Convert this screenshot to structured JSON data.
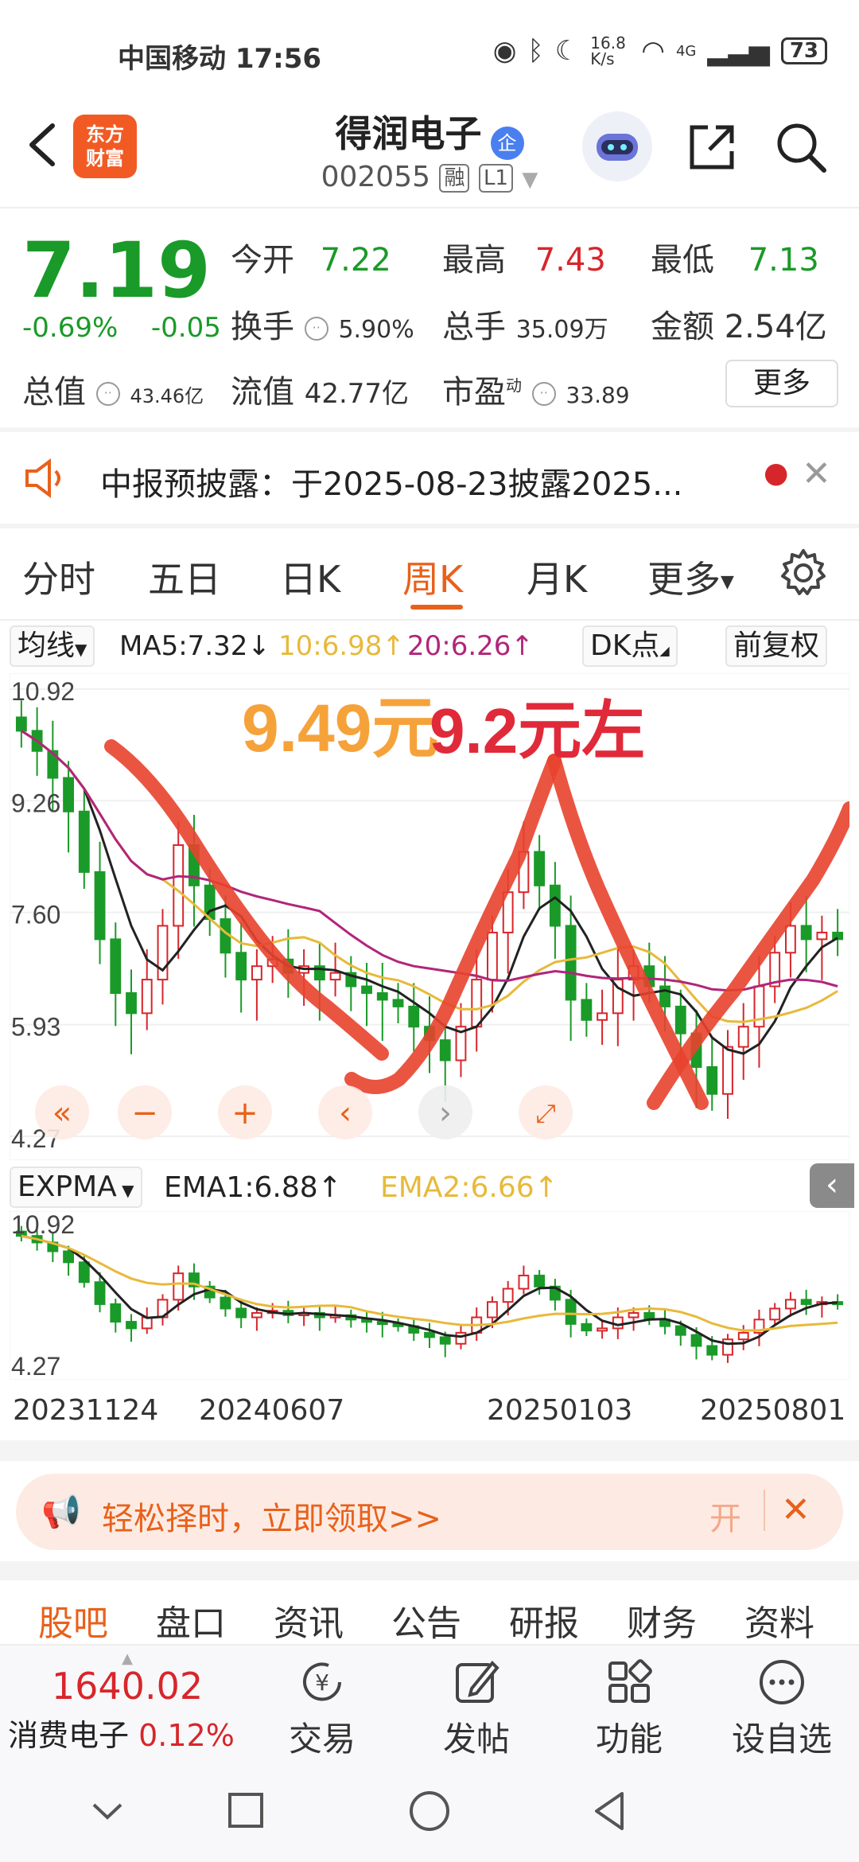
{
  "status_bar": {
    "carrier_time": "中国移动 17:56",
    "net_speed": "16.8 K/s",
    "signal_label": "4G",
    "battery": "73"
  },
  "header": {
    "logo_text_1": "东方",
    "logo_text_2": "财富",
    "stock_name": "得润电子",
    "badge": "企",
    "stock_code": "002055",
    "tag_margin": "融",
    "tag_level": "L1"
  },
  "quote": {
    "price": "7.19",
    "change_pct": "-0.69%",
    "change_abs": "-0.05",
    "open_label": "今开",
    "open": "7.22",
    "high_label": "最高",
    "high": "7.43",
    "low_label": "最低",
    "low": "7.13",
    "turnover_label": "换手",
    "turnover": "5.90%",
    "volume_label": "总手",
    "volume": "35.09万",
    "amount_label": "金额",
    "amount": "2.54亿",
    "mktcap_label": "总值",
    "mktcap": "43.46亿",
    "float_label": "流值",
    "float": "42.77亿",
    "pe_label": "市盈",
    "pe_sup": "动",
    "pe": "33.89",
    "more": "更多"
  },
  "notice": {
    "text": "中报预披露：于2025-08-23披露2025..."
  },
  "chart_tabs": [
    "分时",
    "五日",
    "日K",
    "周K",
    "月K",
    "更多"
  ],
  "active_tab": "周K",
  "ma_row": {
    "selector": "均线",
    "ma5": "MA5:7.32↓",
    "ma10": "10:6.98↑",
    "ma20": "20:6.26↑",
    "dk": "DK点",
    "adjust": "前复权"
  },
  "main_chart": {
    "y_labels": [
      "10.92",
      "9.26",
      "7.60",
      "5.93",
      "4.27"
    ],
    "annotation_1": "9.49元",
    "annotation_2": "9.2元左"
  },
  "sub_row": {
    "indicator": "EXPMA",
    "ema1": "EMA1:6.88↑",
    "ema2": "EMA2:6.66↑"
  },
  "sub_chart": {
    "y_labels": [
      "10.92",
      "4.27"
    ]
  },
  "dates": [
    "20231124",
    "20240607",
    "20250103",
    "20250801"
  ],
  "banner": {
    "text": "轻松择时，立即领取>>",
    "open": "开"
  },
  "bottom_tabs": [
    "股吧",
    "盘口",
    "资讯",
    "公告",
    "研报",
    "财务",
    "资料"
  ],
  "active_bottom_tab": "股吧",
  "bottom_bar": {
    "index_value": "1640.02",
    "index_name": "消费电子",
    "index_change": "0.12%",
    "trade": "交易",
    "post": "发帖",
    "func": "功能",
    "watch": "设自选"
  },
  "colors": {
    "accent": "#e8611b",
    "up": "#d7262b",
    "down": "#1a9a28",
    "ma10": "#e8b93a",
    "ma20": "#b0267a",
    "ink": "#e8432e"
  },
  "chart_data": {
    "type": "candlestick",
    "period": "weekly",
    "ylim": [
      4.27,
      10.92
    ],
    "y_ticks": [
      10.92,
      9.26,
      7.6,
      5.93,
      4.27
    ],
    "x_ticks": [
      "20231124",
      "20240607",
      "20250103",
      "20250801"
    ],
    "last": {
      "price": 7.19,
      "open": 7.22,
      "high": 7.43,
      "low": 7.13
    },
    "series": [
      {
        "name": "MA5",
        "last": 7.32
      },
      {
        "name": "MA10",
        "last": 6.98
      },
      {
        "name": "MA20",
        "last": 6.26
      }
    ],
    "close_path": [
      10.3,
      10.0,
      9.6,
      9.1,
      8.2,
      7.2,
      6.4,
      6.1,
      6.6,
      7.4,
      8.6,
      8.0,
      7.5,
      7.0,
      6.6,
      6.8,
      6.9,
      6.7,
      6.8,
      6.6,
      6.7,
      6.5,
      6.4,
      6.3,
      6.2,
      5.9,
      5.7,
      5.4,
      5.9,
      6.6,
      7.3,
      7.9,
      8.5,
      8.0,
      7.4,
      6.3,
      6.0,
      6.1,
      6.6,
      6.8,
      6.5,
      6.2,
      5.8,
      5.3,
      4.9,
      5.6,
      5.9,
      6.5,
      7.0,
      7.4,
      7.2,
      7.3,
      7.2
    ]
  }
}
